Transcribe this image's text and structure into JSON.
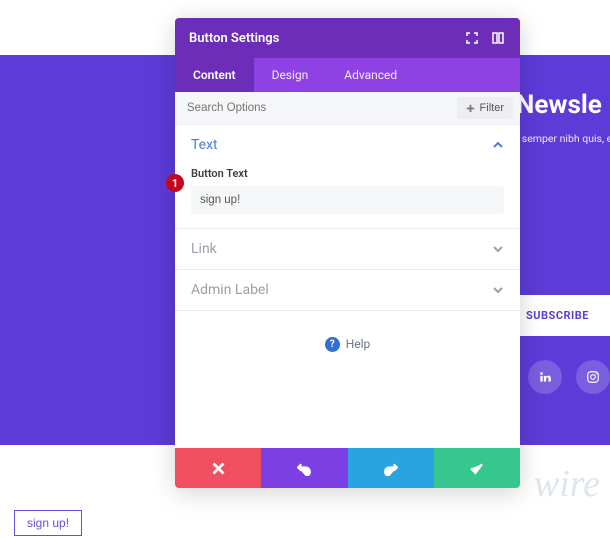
{
  "hero": {
    "title": "r Newsle",
    "subtitle": "pus, semper nibh quis, e",
    "subscribe_label": "SUBSCRIBE"
  },
  "annotation": {
    "num": "1"
  },
  "standalone_button": {
    "label": "sign up!"
  },
  "watermark": "wire",
  "panel": {
    "title": "Button Settings",
    "tabs": [
      {
        "label": "Content",
        "active": true
      },
      {
        "label": "Design",
        "active": false
      },
      {
        "label": "Advanced",
        "active": false
      }
    ],
    "search_placeholder": "Search Options",
    "filter_label": "Filter",
    "sections": {
      "text": {
        "title": "Text",
        "field_label": "Button Text",
        "field_value": "sign up!"
      },
      "link": {
        "title": "Link"
      },
      "admin": {
        "title": "Admin Label"
      }
    },
    "help_label": "Help",
    "footer_colors": {
      "cancel": "#ef4f60",
      "undo": "#7c3fe4",
      "redo": "#2aa4e0",
      "ok": "#36c78f"
    }
  }
}
